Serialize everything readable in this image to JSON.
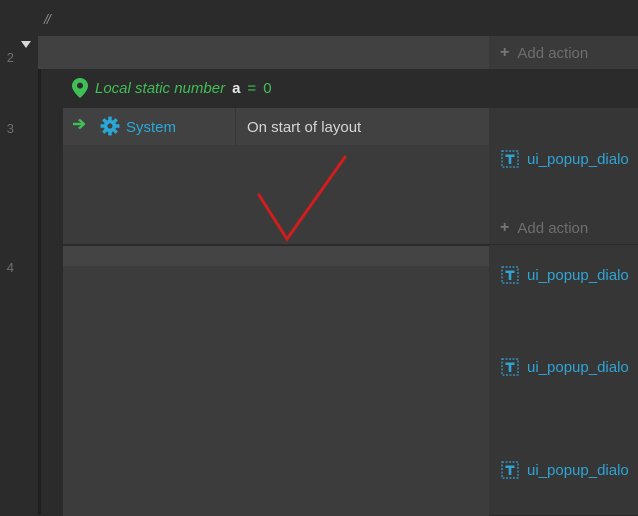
{
  "rows": {
    "row2": {
      "number": "2",
      "comment_glyph": "//",
      "add_action": "Add action"
    },
    "row3": {
      "number": "3",
      "local_var": {
        "label": "Local static number",
        "name": "a",
        "equals": "=",
        "value": "0"
      },
      "condition": {
        "object": "System",
        "text": "On start of layout"
      },
      "actions": [
        {
          "label": "ui_popup_dialo"
        }
      ],
      "add_action": "Add action"
    },
    "row4": {
      "number": "4",
      "actions": [
        {
          "label": "ui_popup_dialo"
        },
        {
          "label": "ui_popup_dialo"
        },
        {
          "label": "ui_popup_dialo"
        }
      ]
    }
  },
  "icons": {
    "collapse": "triangle-down-icon",
    "local_var": "map-pin-icon",
    "trigger": "arrow-right-icon",
    "system": "gear-icon",
    "action_obj": "text-object-icon",
    "annotation": "red-checkmark"
  },
  "colors": {
    "accent_blue": "#29a8d8",
    "accent_green": "#3fbf55",
    "annotation_red": "#d21d1d"
  }
}
